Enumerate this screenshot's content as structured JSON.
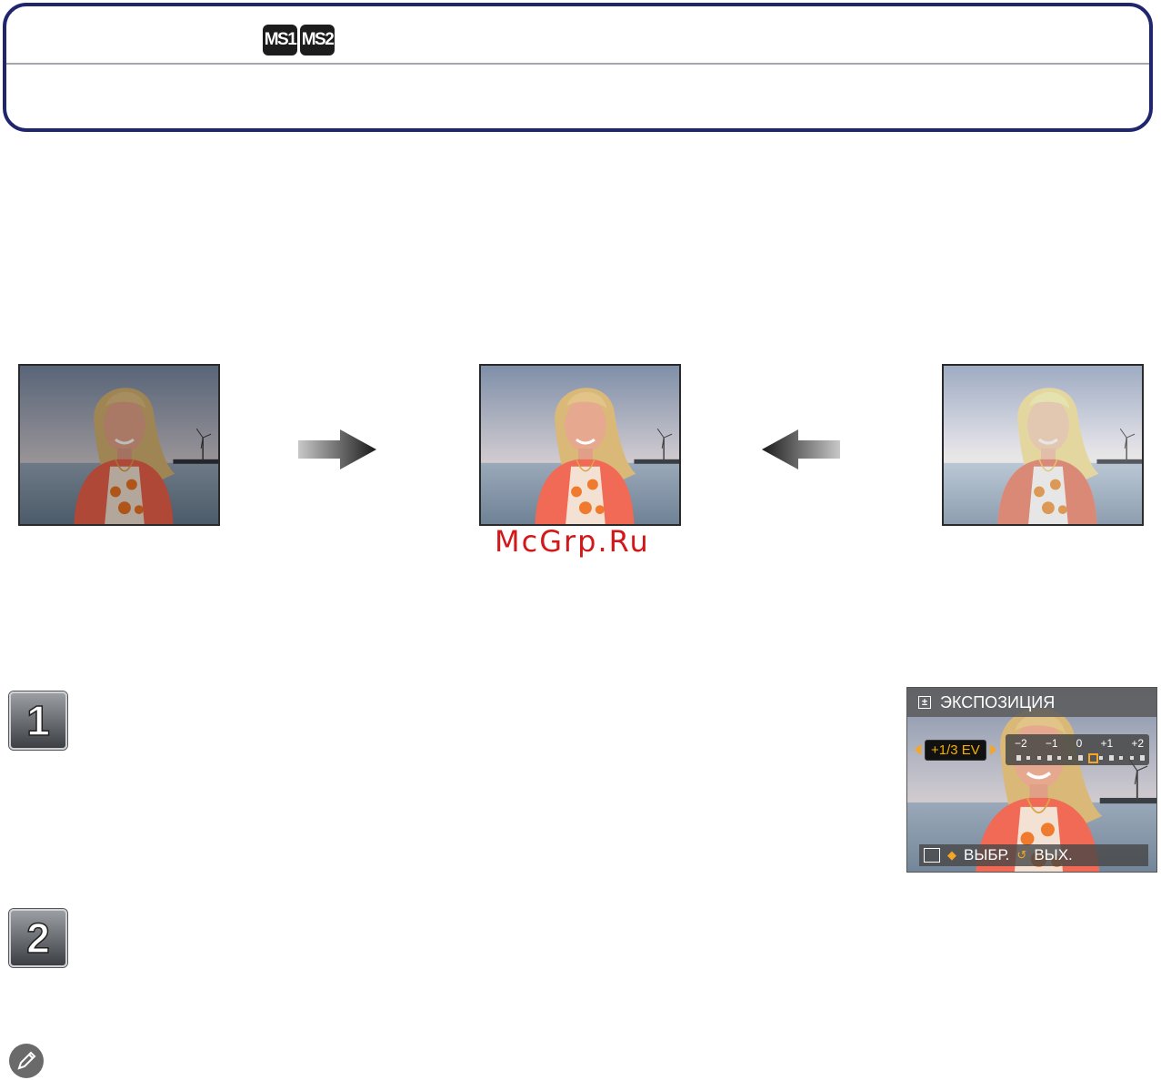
{
  "header": {
    "mode_badges": [
      {
        "label": "MS1"
      },
      {
        "label": "MS2"
      }
    ]
  },
  "watermark": "McGrp.Ru",
  "steps": [
    {
      "number": "1"
    },
    {
      "number": "2"
    }
  ],
  "camera_screen": {
    "title": "ЭКСПОЗИЦИЯ",
    "ev_value": "+1/3 EV",
    "scale_labels": [
      "−2",
      "−1",
      "0",
      "+1",
      "+2"
    ],
    "selected_step": 7,
    "bottom_select": "ВЫБР.",
    "bottom_exit": "ВЫХ."
  },
  "colors": {
    "header_border": "#20266d",
    "watermark": "#d21818",
    "highlight": "#f5a623"
  }
}
